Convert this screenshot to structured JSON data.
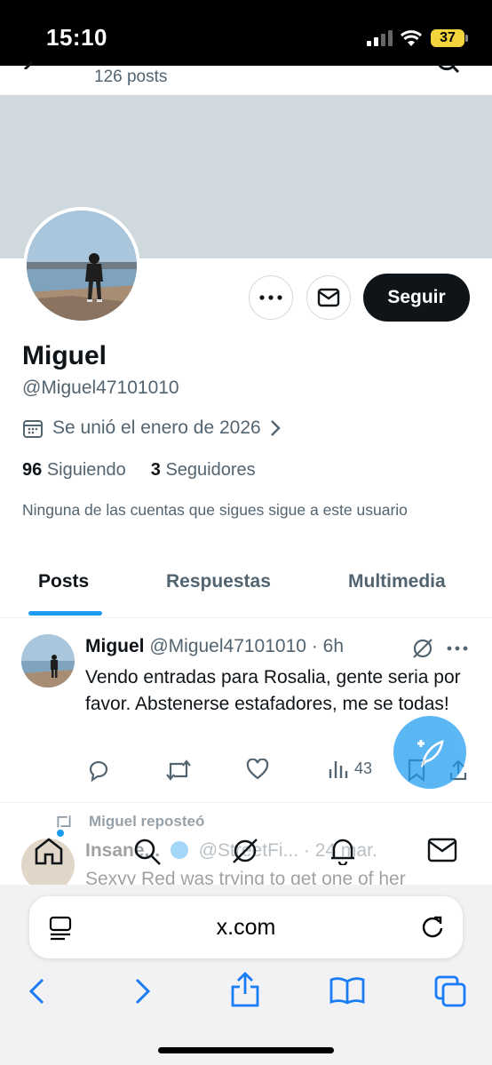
{
  "status_bar": {
    "time": "15:10",
    "battery": "37"
  },
  "header": {
    "post_count": "126 posts"
  },
  "profile": {
    "display_name": "Miguel",
    "handle": "@Miguel47101010",
    "joined": "Se unió el enero de 2026",
    "following_count": "96",
    "following_label": "Siguiendo",
    "followers_count": "3",
    "followers_label": "Seguidores",
    "mutuals_note": "Ninguna de las cuentas que sigues sigue a este usuario",
    "follow_button": "Seguir"
  },
  "tabs": [
    {
      "label": "Posts",
      "active": true
    },
    {
      "label": "Respuestas",
      "active": false
    },
    {
      "label": "Multimedia",
      "active": false
    }
  ],
  "tweet": {
    "name": "Miguel",
    "handle": "@Miguel47101010",
    "time": "· 6h",
    "text": "Vendo entradas para Rosalia, gente seria por favor. Abstenerse estafadores, me se todas!",
    "views": "43"
  },
  "repost": {
    "label": "Miguel reposteó",
    "name": "Insane...",
    "handle": "@StreetFi...",
    "time": "· 24 mar.",
    "text": "Sexyy Red was trying to get one of her"
  },
  "safari": {
    "url": "x.com"
  },
  "colors": {
    "accent": "#1d9bf0",
    "banner": "#cfd9de",
    "text_secondary": "#536471"
  }
}
